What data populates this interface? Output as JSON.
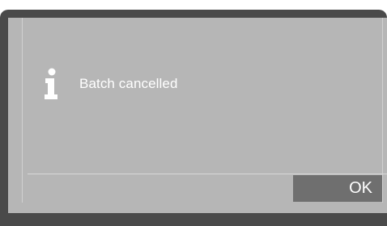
{
  "dialog": {
    "icon": "info-icon",
    "message": "Batch cancelled",
    "ok_label": "OK"
  },
  "colors": {
    "frame": "#4a4a4a",
    "screen_background": "#b6b6b6",
    "button_background": "#6f6f6f",
    "text": "#ffffff"
  }
}
